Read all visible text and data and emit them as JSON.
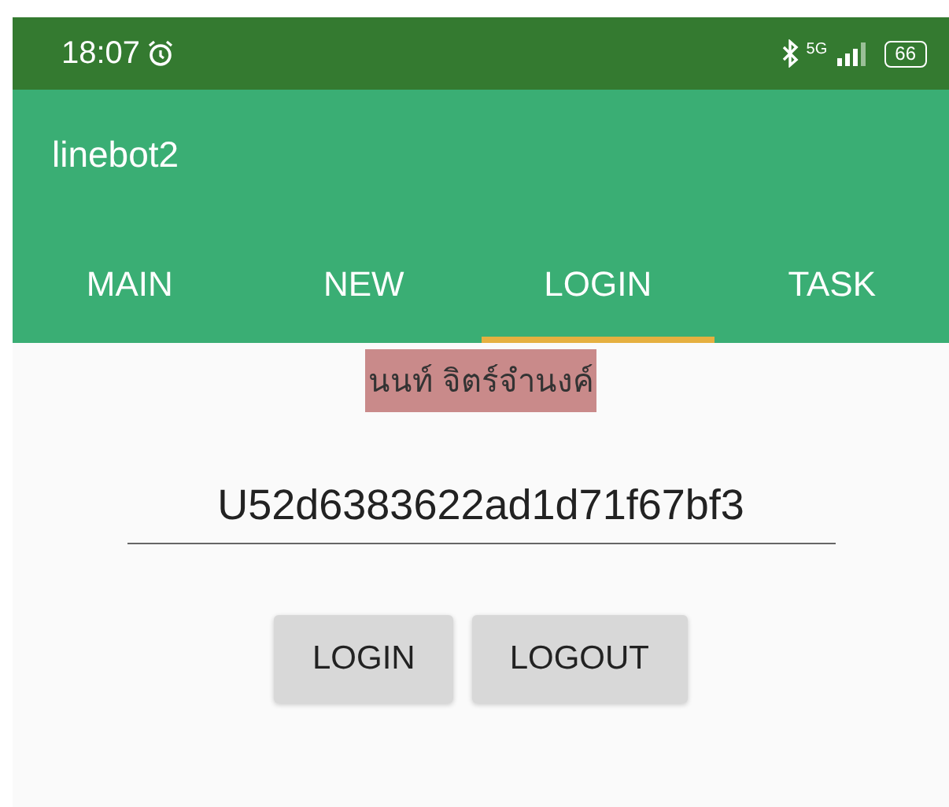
{
  "status_bar": {
    "time": "18:07",
    "network": "5G",
    "battery": "66"
  },
  "app_bar": {
    "title": "linebot2"
  },
  "tabs": [
    {
      "label": "MAIN",
      "selected": false
    },
    {
      "label": "NEW",
      "selected": false
    },
    {
      "label": "LOGIN",
      "selected": true
    },
    {
      "label": "TASK",
      "selected": false
    }
  ],
  "user_name": "นนท์ จิตร์จำนงค์",
  "user_id_field": {
    "value": "U52d6383622ad1d71f67bf3"
  },
  "buttons": [
    "LOGIN",
    "LOGOUT"
  ]
}
